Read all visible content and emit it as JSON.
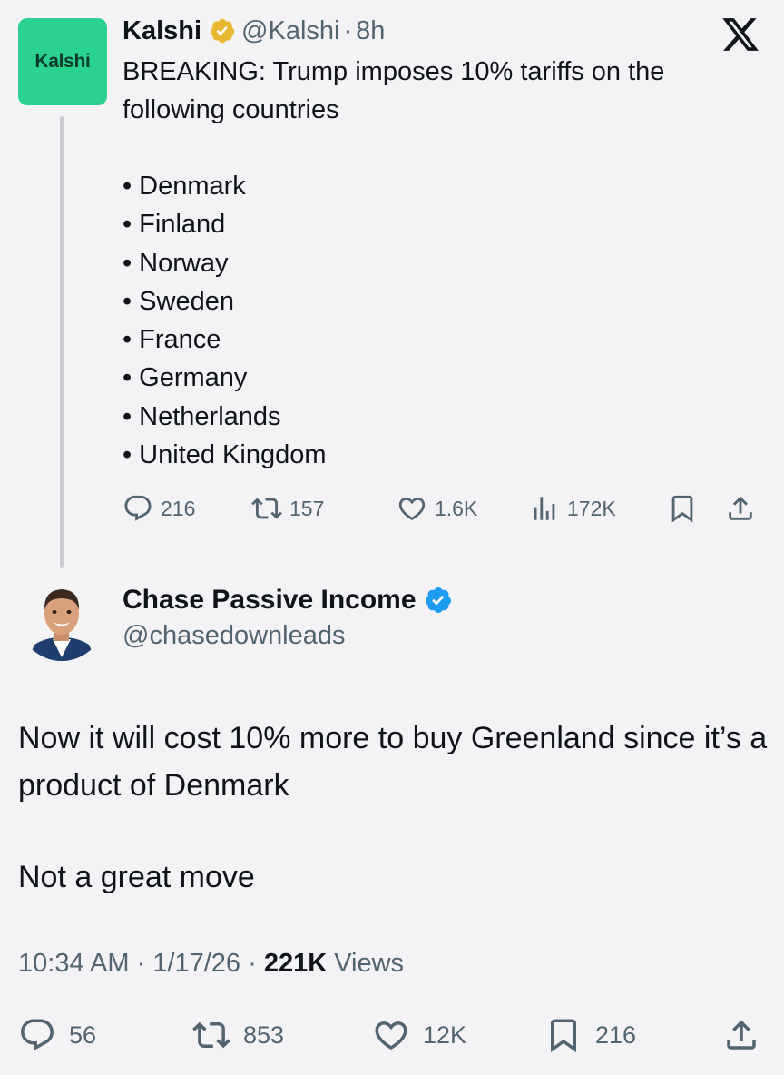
{
  "quoted_tweet": {
    "avatar_text": "Kalshi",
    "author_name": "Kalshi",
    "handle": "@Kalshi",
    "separator": "·",
    "time": "8h",
    "text": "BREAKING: Trump imposes 10% tariffs on the following countries",
    "countries": [
      "Denmark",
      "Finland",
      "Norway",
      "Sweden",
      "France",
      "Germany",
      "Netherlands",
      "United Kingdom"
    ],
    "replies": "216",
    "retweets": "157",
    "likes": "1.6K",
    "views": "172K",
    "verified_badge_color": "#e8b930"
  },
  "main_tweet": {
    "author_name": "Chase Passive Income",
    "handle": "@chasedownleads",
    "text_line1": "Now it will cost 10% more to buy Greenland since it’s a product of Denmark",
    "text_line2": "Not a great move",
    "timestamp": "10:34 AM · 1/17/26 · ",
    "views_count": "221K",
    "views_label": " Views",
    "replies": "56",
    "retweets": "853",
    "likes": "12K",
    "bookmarks": "216",
    "verified_badge_color": "#1d9bf0"
  },
  "icons": [
    "x-logo-icon",
    "verified-badge-icon",
    "reply-icon",
    "retweet-icon",
    "like-icon",
    "views-icon",
    "bookmark-icon",
    "share-icon"
  ]
}
